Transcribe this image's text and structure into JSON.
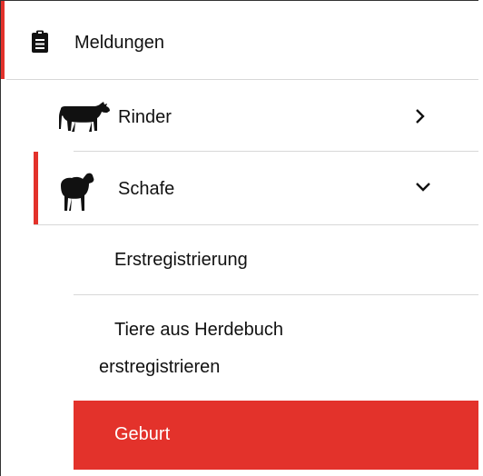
{
  "nav": {
    "top": {
      "label": "Meldungen",
      "icon": "clipboard-icon"
    },
    "species": [
      {
        "label": "Rinder",
        "icon": "cow-icon",
        "expanded": false,
        "chevron": "chevron-right-icon"
      },
      {
        "label": "Schafe",
        "icon": "sheep-icon",
        "expanded": true,
        "chevron": "chevron-down-icon"
      }
    ],
    "sub_items": [
      {
        "label": "Erstregistrierung",
        "active": false
      },
      {
        "label_line1": "Tiere aus Herdebuch",
        "label_line2": "erstregistrieren",
        "active": false
      },
      {
        "label": "Geburt",
        "active": true
      }
    ]
  },
  "colors": {
    "accent": "#e3322b",
    "separator": "#d8d8d8",
    "text": "#111111"
  }
}
